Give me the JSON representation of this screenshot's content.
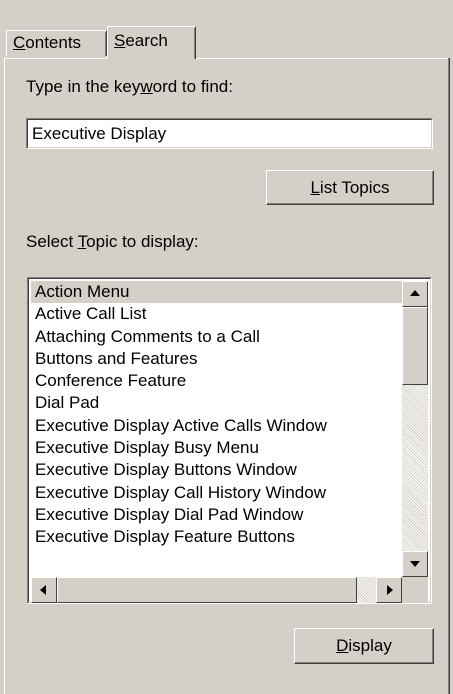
{
  "tabs": [
    {
      "label_underlined": "C",
      "label_rest": "ontents"
    },
    {
      "label_underlined": "S",
      "label_rest": "earch"
    }
  ],
  "keyword_label": {
    "pre": "Type in the key",
    "underlined": "w",
    "post": "ord to find:"
  },
  "keyword_value": "Executive Display",
  "list_topics_button": {
    "underlined": "L",
    "rest": "ist Topics"
  },
  "topic_label": {
    "pre": "Select ",
    "underlined": "T",
    "post": "opic to display:"
  },
  "topics": [
    "Action Menu",
    "Active Call List",
    "Attaching Comments to a Call",
    "Buttons and Features",
    "Conference Feature",
    "Dial Pad",
    "Executive Display Active Calls Window",
    "Executive Display Busy Menu",
    "Executive Display Buttons Window",
    "Executive Display Call History Window",
    "Executive Display Dial Pad Window",
    "Executive Display Feature Buttons"
  ],
  "selected_topic": "Action Menu",
  "display_button": {
    "underlined": "D",
    "rest": "isplay"
  },
  "icons": {
    "scroll_up": "triangle-up",
    "scroll_down": "triangle-down",
    "scroll_left": "triangle-left",
    "scroll_right": "triangle-right"
  }
}
